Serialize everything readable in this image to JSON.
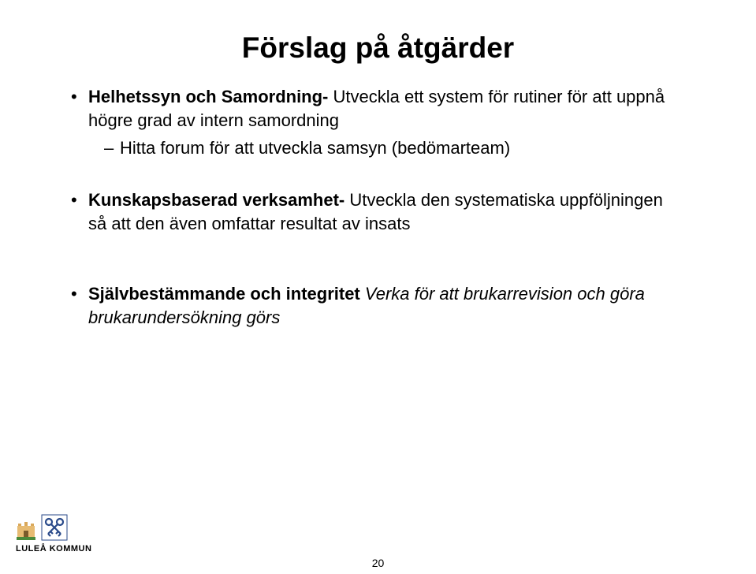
{
  "title": "Förslag på åtgärder",
  "bullets": [
    {
      "lead_bold": "Helhetssyn och Samordning-",
      "rest": " Utveckla ett system för rutiner för att uppnå högre grad av intern samordning",
      "sub": [
        {
          "text": "Hitta forum för att utveckla samsyn (bedömarteam)"
        }
      ]
    },
    {
      "lead_bold": "Kunskapsbaserad verksamhet-",
      "rest": "  Utveckla den systematiska uppföljningen så att den även omfattar resultat av insats",
      "sub": []
    },
    {
      "lead_bold": "Självbestämmande och integritet ",
      "italic": "Verka för att brukarrevision och göra brukarundersökning görs",
      "sub": []
    }
  ],
  "page_number": "20",
  "logo": {
    "text": "LULEÅ KOMMUN"
  }
}
